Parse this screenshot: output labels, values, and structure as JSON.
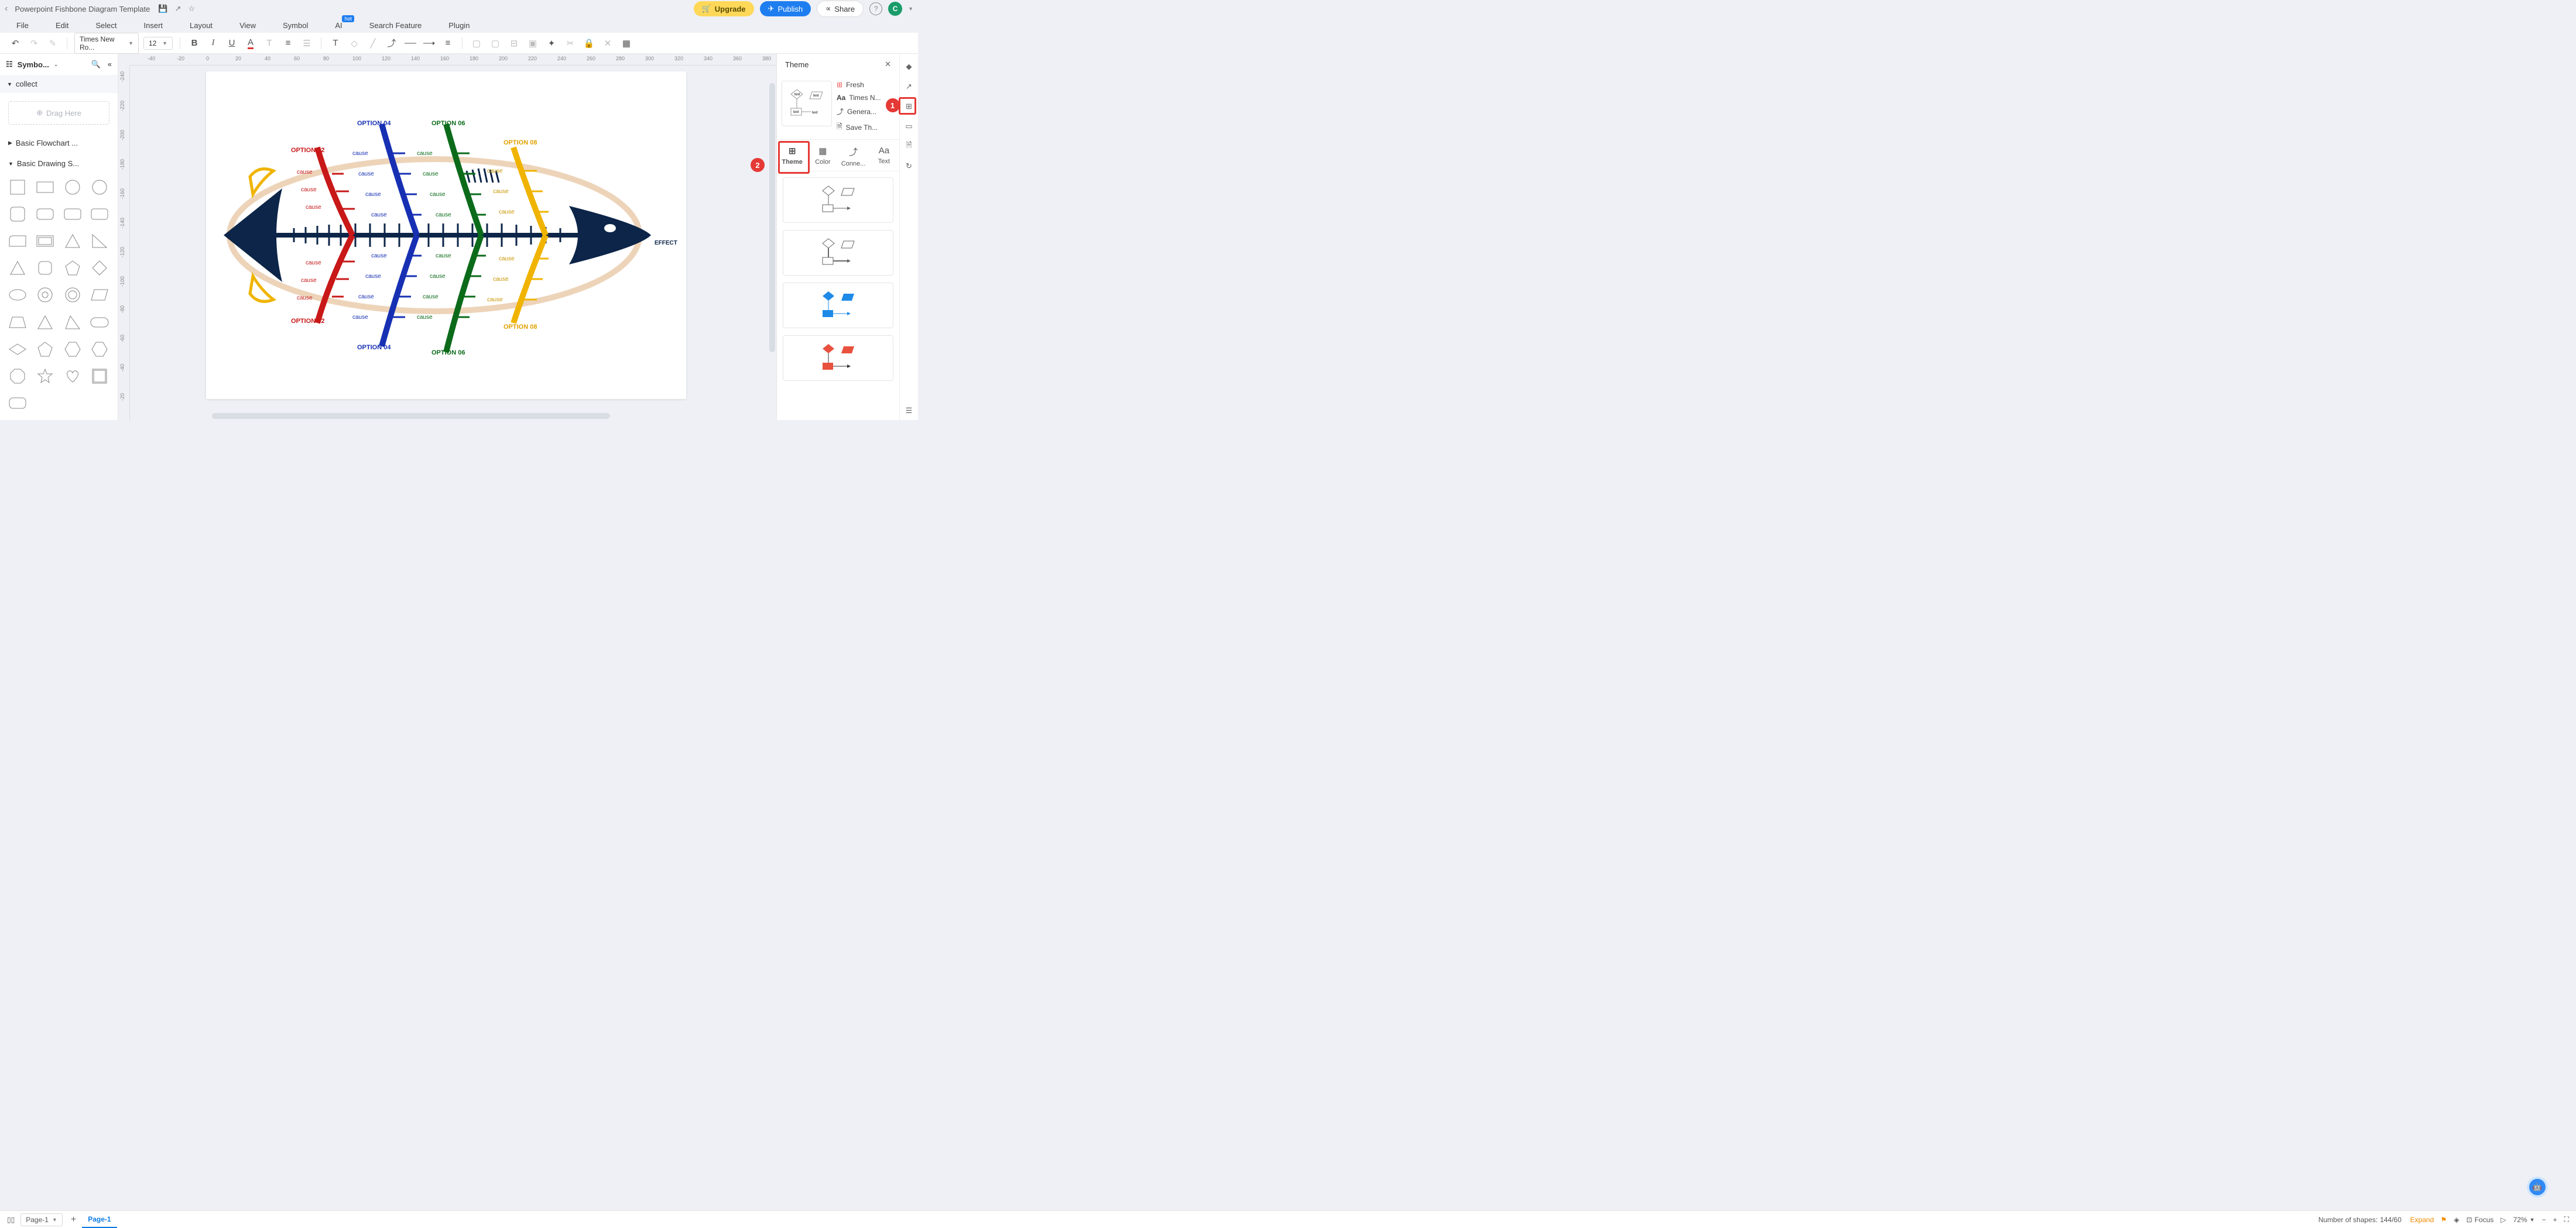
{
  "title": "Powerpoint Fishbone Diagram Template",
  "buttons": {
    "upgrade": "Upgrade",
    "publish": "Publish",
    "share": "Share"
  },
  "avatar": "C",
  "menu": [
    "File",
    "Edit",
    "Select",
    "Insert",
    "Layout",
    "View",
    "Symbol",
    "AI",
    "Search Feature",
    "Plugin"
  ],
  "hot_badge": "hot",
  "toolbar": {
    "font": "Times New Ro...",
    "size": "12"
  },
  "sidebar": {
    "title": "Symbo...",
    "collect": "collect",
    "drag": "Drag Here",
    "lib1": "Basic Flowchart ...",
    "lib2": "Basic Drawing S..."
  },
  "theme": {
    "title": "Theme",
    "fresh": "Fresh",
    "font": "Times N...",
    "genera": "Genera...",
    "save": "Save Th...",
    "tabs": {
      "theme": "Theme",
      "color": "Color",
      "conne": "Conne...",
      "text": "Text"
    }
  },
  "fishbone": {
    "effect": "EFFECT",
    "opt02": "OPTION  02",
    "opt04": "OPTION  04",
    "opt06": "OPTION  06",
    "opt08": "OPTION  08",
    "cause": "cause"
  },
  "status": {
    "page_sel": "Page-1",
    "page_tab": "Page-1",
    "shapes_label": "Number of shapes: ",
    "shapes_val": "144/60",
    "expand": "Expand",
    "focus": "Focus",
    "zoom": "72%"
  },
  "callouts": {
    "one": "1",
    "two": "2"
  },
  "ruler_h": [
    "-40",
    "-20",
    "0",
    "20",
    "40",
    "60",
    "80",
    "100",
    "120",
    "140",
    "160",
    "180",
    "200",
    "220",
    "240",
    "260",
    "280",
    "300",
    "320",
    "340",
    "360",
    "380"
  ],
  "ruler_v": [
    "-240",
    "-220",
    "-200",
    "-180",
    "-160",
    "-140",
    "-120",
    "-100",
    "-80",
    "-60",
    "-40",
    "-20"
  ]
}
